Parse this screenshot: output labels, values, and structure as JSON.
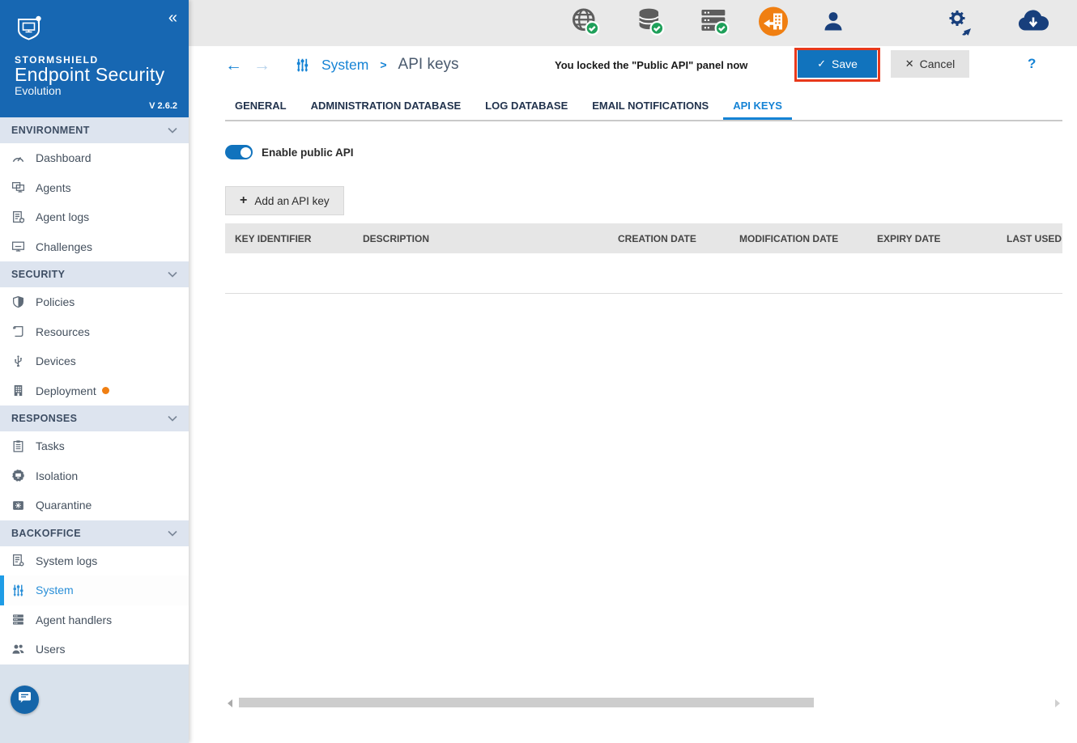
{
  "logo": {
    "brand": "STORMSHIELD",
    "product": "Endpoint Security",
    "edition": "Evolution",
    "version": "V 2.6.2",
    "collapse_glyph": "«"
  },
  "sidebar": {
    "sections": [
      {
        "title": "ENVIRONMENT",
        "items": [
          {
            "label": "Dashboard",
            "icon": "gauge-icon"
          },
          {
            "label": "Agents",
            "icon": "monitors-icon"
          },
          {
            "label": "Agent logs",
            "icon": "document-shield-icon"
          },
          {
            "label": "Challenges",
            "icon": "monitor-icon"
          }
        ]
      },
      {
        "title": "SECURITY",
        "items": [
          {
            "label": "Policies",
            "icon": "shield-icon"
          },
          {
            "label": "Resources",
            "icon": "scroll-icon"
          },
          {
            "label": "Devices",
            "icon": "usb-icon"
          },
          {
            "label": "Deployment",
            "icon": "building-icon",
            "badge": "orange-dot"
          }
        ]
      },
      {
        "title": "RESPONSES",
        "items": [
          {
            "label": "Tasks",
            "icon": "clipboard-icon"
          },
          {
            "label": "Isolation",
            "icon": "isolated-monitor-icon"
          },
          {
            "label": "Quarantine",
            "icon": "quarantine-folder-icon"
          }
        ]
      },
      {
        "title": "BACKOFFICE",
        "items": [
          {
            "label": "System logs",
            "icon": "document-gear-icon"
          },
          {
            "label": "System",
            "icon": "sliders-icon",
            "active": true
          },
          {
            "label": "Agent handlers",
            "icon": "server-icon"
          },
          {
            "label": "Users",
            "icon": "users-icon"
          }
        ]
      }
    ]
  },
  "topbar": {
    "icons": [
      {
        "name": "web-service-status",
        "status": "ok"
      },
      {
        "name": "database-status",
        "status": "ok"
      },
      {
        "name": "agent-handler-status",
        "status": "ok"
      },
      {
        "name": "deployment-pending",
        "color": "#f07f12"
      },
      {
        "name": "user-account"
      },
      {
        "name": "services-gear"
      },
      {
        "name": "cloud-sync"
      }
    ]
  },
  "toolbar": {
    "back_glyph": "←",
    "forward_glyph": "→",
    "breadcrumb": {
      "section": "System",
      "separator": ">",
      "page": "API keys"
    },
    "notification": "You locked the \"Public API\" panel now",
    "save_glyph": "✓",
    "save_label": "Save",
    "cancel_glyph": "✕",
    "cancel_label": "Cancel",
    "help_label": "?",
    "annotation_color": "#e8391b"
  },
  "tabs": [
    {
      "label": "GENERAL",
      "active": false
    },
    {
      "label": "ADMINISTRATION DATABASE",
      "active": false
    },
    {
      "label": "LOG DATABASE",
      "active": false
    },
    {
      "label": "EMAIL NOTIFICATIONS",
      "active": false
    },
    {
      "label": "API KEYS",
      "active": true
    }
  ],
  "content": {
    "toggle_label": "Enable public API",
    "toggle_on": true,
    "add_button": {
      "plus_glyph": "+",
      "label": "Add an API key"
    },
    "table": {
      "columns": [
        "KEY IDENTIFIER",
        "DESCRIPTION",
        "CREATION DATE",
        "MODIFICATION DATE",
        "EXPIRY DATE",
        "LAST USED"
      ],
      "rows": []
    }
  },
  "colors": {
    "sidebar_blue": "#1767b2",
    "accent_blue": "#1583d5",
    "save_blue": "#1173bd",
    "active_bar": "#1e9ce6",
    "status_green": "#1fa05a",
    "status_orange": "#f07f12",
    "annotation_red": "#e8391b"
  }
}
